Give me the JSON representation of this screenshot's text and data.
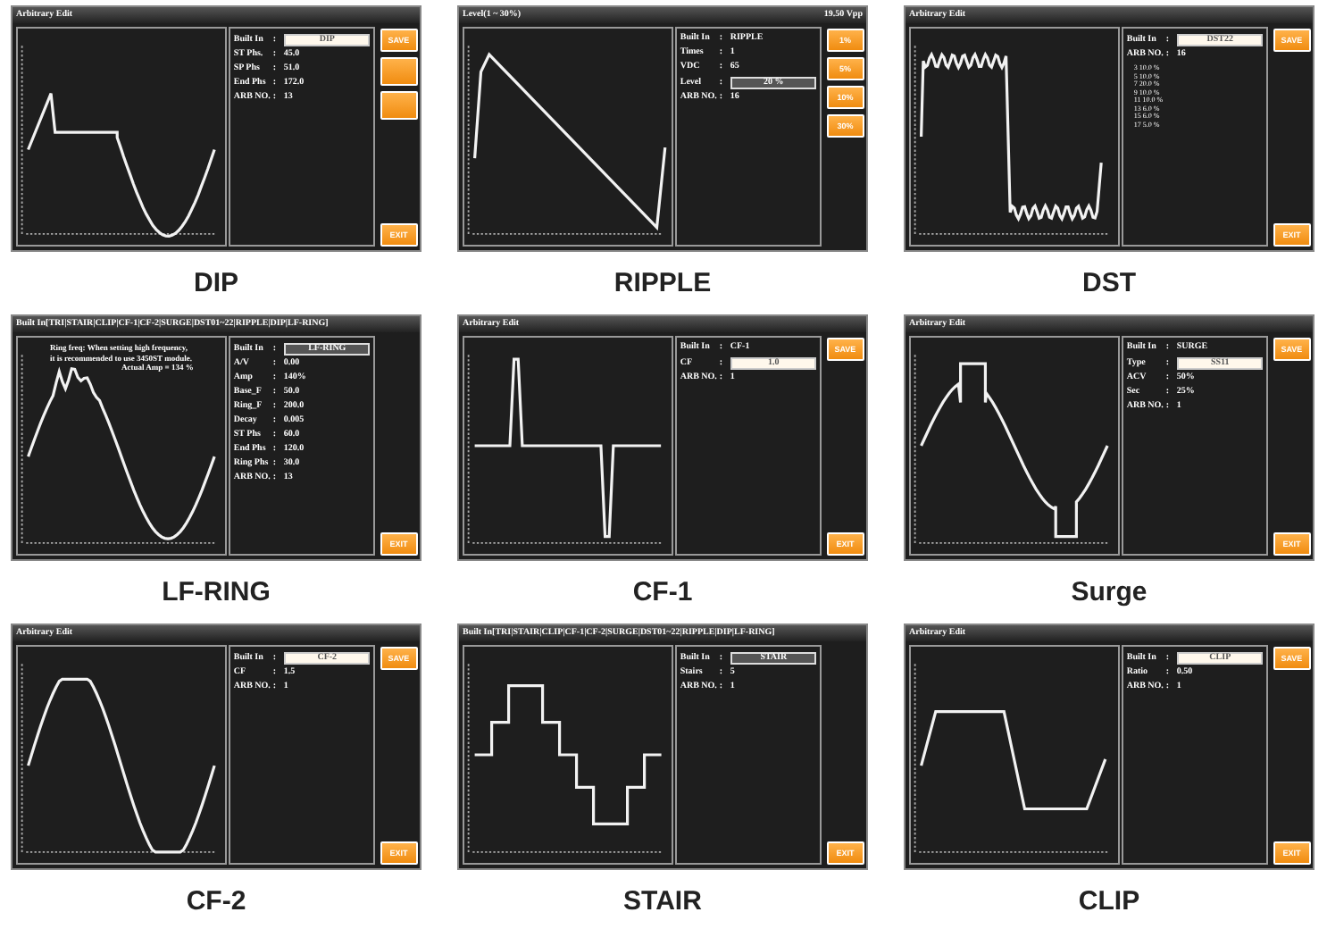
{
  "panels": [
    {
      "caption": "DIP",
      "kind": "dip",
      "title": "Arbitrary Edit",
      "params": [
        {
          "label": "Built In",
          "sep": ":",
          "value": "DIP",
          "kind": "field"
        },
        {
          "label": "ST Phs.",
          "sep": ":",
          "value": "45.0",
          "kind": "text"
        },
        {
          "label": "SP Phs",
          "sep": ":",
          "value": "51.0",
          "kind": "text"
        },
        {
          "label": "End Phs",
          "sep": ":",
          "value": "172.0",
          "kind": "text"
        },
        {
          "label": "ARB NO.",
          "sep": ":",
          "value": "13",
          "kind": "text"
        }
      ],
      "buttons": [
        {
          "label": "SAVE",
          "kind": "small"
        },
        {
          "kind": "tall"
        },
        {
          "kind": "tall"
        }
      ],
      "exit": "EXIT"
    },
    {
      "caption": "RIPPLE",
      "kind": "ripple",
      "title": "Level(1 ~ 30%)",
      "title_right": "19.50 Vpp",
      "params": [
        {
          "label": "Built In",
          "sep": ":",
          "value": "RIPPLE",
          "kind": "text"
        },
        {
          "label": "Times",
          "sep": ":",
          "value": "1",
          "kind": "text"
        },
        {
          "label": "VDC",
          "sep": ":",
          "value": "65",
          "kind": "text"
        },
        {
          "label": "Level",
          "sep": ":",
          "value": "20 %",
          "kind": "active"
        },
        {
          "label": "ARB NO.",
          "sep": ":",
          "value": "16",
          "kind": "text"
        }
      ],
      "buttons": [
        {
          "label": "1%",
          "kind": "small"
        },
        {
          "label": "5%",
          "kind": "small"
        },
        {
          "label": "10%",
          "kind": "small"
        },
        {
          "label": "30%",
          "kind": "small"
        }
      ]
    },
    {
      "caption": "DST",
      "kind": "dst",
      "title": "Arbitrary Edit",
      "params": [
        {
          "label": "Built In",
          "sep": ":",
          "value": "DST22",
          "kind": "field"
        },
        {
          "label": "ARB NO.",
          "sep": ":",
          "value": "16",
          "kind": "text"
        }
      ],
      "notes": [
        "3 10.0 %",
        "5 10.0 %",
        "7 20.0 %",
        "9 10.0 %",
        "11 10.0 %",
        "13 6.0 %",
        "15 6.0 %",
        "17 5.0 %"
      ],
      "buttons": [
        {
          "label": "SAVE",
          "kind": "small"
        }
      ],
      "exit": "EXIT"
    },
    {
      "caption": "LF-RING",
      "kind": "lfring",
      "title": "Built In[TRI|STAIR|CLIP|CF-1|CF-2|SURGE|DST01~22|RIPPLE|DIP|LF-RING]",
      "message": [
        "Ring freq: When setting high frequency,",
        "it is recommended to use 3450ST module.",
        "Actual Amp = 134 %"
      ],
      "params": [
        {
          "label": "Built In",
          "sep": ":",
          "value": "LF-RING",
          "kind": "active"
        },
        {
          "label": "A/V",
          "sep": ":",
          "value": "0.00",
          "kind": "text"
        },
        {
          "label": "Amp",
          "sep": ":",
          "value": "140%",
          "kind": "text"
        },
        {
          "label": "Base_F",
          "sep": ":",
          "value": "50.0",
          "kind": "text"
        },
        {
          "label": "Ring_F",
          "sep": ":",
          "value": "200.0",
          "kind": "text"
        },
        {
          "label": "Decay",
          "sep": ":",
          "value": "0.005",
          "kind": "text"
        },
        {
          "label": "ST Phs",
          "sep": ":",
          "value": "60.0",
          "kind": "text"
        },
        {
          "label": "End Phs",
          "sep": ":",
          "value": "120.0",
          "kind": "text"
        },
        {
          "label": "Ring Phs",
          "sep": ":",
          "value": "30.0",
          "kind": "text"
        },
        {
          "label": "ARB NO.",
          "sep": ":",
          "value": "13",
          "kind": "text"
        }
      ],
      "exit": "EXIT"
    },
    {
      "caption": "CF-1",
      "kind": "cf1",
      "title": "Arbitrary Edit",
      "params": [
        {
          "label": "Built In",
          "sep": ":",
          "value": "CF-1",
          "kind": "text"
        },
        {
          "label": "CF",
          "sep": ":",
          "value": "1.0",
          "kind": "field"
        },
        {
          "label": "ARB NO.",
          "sep": ":",
          "value": "1",
          "kind": "text"
        }
      ],
      "buttons": [
        {
          "label": "SAVE",
          "kind": "small"
        }
      ],
      "exit": "EXIT"
    },
    {
      "caption": "Surge",
      "kind": "surge",
      "title": "Arbitrary Edit",
      "params": [
        {
          "label": "Built In",
          "sep": ":",
          "value": "SURGE",
          "kind": "text"
        },
        {
          "label": "Type",
          "sep": ":",
          "value": "SS11",
          "kind": "field"
        },
        {
          "label": "ACV",
          "sep": ":",
          "value": "50%",
          "kind": "text"
        },
        {
          "label": "Sec",
          "sep": ":",
          "value": "25%",
          "kind": "text"
        },
        {
          "label": "ARB NO.",
          "sep": ":",
          "value": "1",
          "kind": "text"
        }
      ],
      "buttons": [
        {
          "label": "SAVE",
          "kind": "small"
        }
      ],
      "exit": "EXIT"
    },
    {
      "caption": "CF-2",
      "kind": "cf2",
      "title": "Arbitrary Edit",
      "params": [
        {
          "label": "Built In",
          "sep": ":",
          "value": "CF-2",
          "kind": "field"
        },
        {
          "label": "CF",
          "sep": ":",
          "value": "1.5",
          "kind": "text"
        },
        {
          "label": "ARB NO.",
          "sep": ":",
          "value": "1",
          "kind": "text"
        }
      ],
      "buttons": [
        {
          "label": "SAVE",
          "kind": "small"
        }
      ],
      "exit": "EXIT"
    },
    {
      "caption": "STAIR",
      "kind": "stair",
      "title": "Built In[TRI|STAIR|CLIP|CF-1|CF-2|SURGE|DST01~22|RIPPLE|DIP|LF-RING]",
      "params": [
        {
          "label": "Built In",
          "sep": ":",
          "value": "STAIR",
          "kind": "active"
        },
        {
          "label": "Stairs",
          "sep": ":",
          "value": "5",
          "kind": "text"
        },
        {
          "label": "ARB NO.",
          "sep": ":",
          "value": "1",
          "kind": "text"
        }
      ],
      "exit": "EXIT"
    },
    {
      "caption": "CLIP",
      "kind": "clip",
      "title": "Arbitrary Edit",
      "params": [
        {
          "label": "Built In",
          "sep": ":",
          "value": "CLIP",
          "kind": "field"
        },
        {
          "label": "Ratio",
          "sep": ":",
          "value": "0.50",
          "kind": "text"
        },
        {
          "label": "ARB NO.",
          "sep": ":",
          "value": "1",
          "kind": "text"
        }
      ],
      "buttons": [
        {
          "label": "SAVE",
          "kind": "small"
        }
      ],
      "exit": "EXIT"
    }
  ]
}
